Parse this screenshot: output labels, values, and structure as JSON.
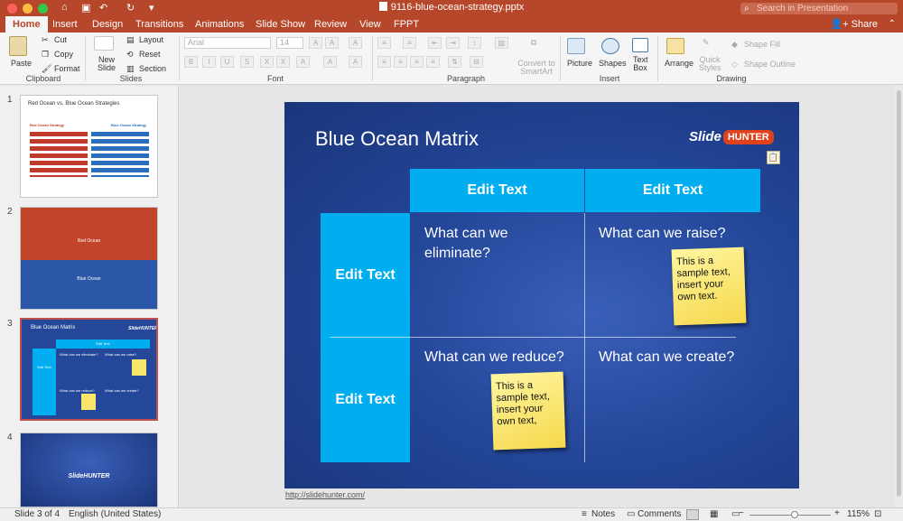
{
  "window": {
    "title": "9116-blue-ocean-strategy.pptx",
    "search_placeholder": "Search in Presentation"
  },
  "tabs": [
    {
      "label": "Home",
      "active": true
    },
    {
      "label": "Insert"
    },
    {
      "label": "Design"
    },
    {
      "label": "Transitions"
    },
    {
      "label": "Animations"
    },
    {
      "label": "Slide Show"
    },
    {
      "label": "Review"
    },
    {
      "label": "View"
    },
    {
      "label": "FPPT"
    }
  ],
  "share_label": "Share",
  "ribbon": {
    "clipboard": {
      "paste": "Paste",
      "cut": "Cut",
      "copy": "Copy",
      "format": "Format",
      "group": "Clipboard"
    },
    "slides": {
      "new_slide": "New Slide",
      "layout": "Layout",
      "reset": "Reset",
      "section": "Section",
      "group": "Slides"
    },
    "font": {
      "font_name": "Arial",
      "font_size": "14",
      "group": "Font"
    },
    "paragraph": {
      "convert": "Convert to SmartArt",
      "group": "Paragraph"
    },
    "insert": {
      "picture": "Picture",
      "shapes": "Shapes",
      "textbox": "Text Box",
      "group": "Insert"
    },
    "drawing": {
      "arrange": "Arrange",
      "quick_styles": "Quick Styles",
      "shape_fill": "Shape Fill",
      "shape_outline": "Shape Outline",
      "group": "Drawing"
    }
  },
  "thumbnails": [
    {
      "num": "1",
      "title": "Red Ocean vs. Blue Ocean Strategies",
      "left": "Red Ocean Strategy",
      "right": "Blue Ocean Strategy"
    },
    {
      "num": "2",
      "top": "Red Ocean",
      "bottom": "Blue Ocean"
    },
    {
      "num": "3",
      "title": "Blue Ocean Matrix",
      "header": "Edit Text",
      "row": "Edit Text",
      "q1": "What can we eliminate?",
      "q2": "What can we raise?",
      "q3": "What can we reduce?",
      "q4": "What can we create?",
      "logo": "SlideHUNTER"
    },
    {
      "num": "4",
      "logo": "SlideHUNTER"
    }
  ],
  "slide": {
    "title": "Blue Ocean Matrix",
    "logo_slide": "Slide",
    "logo_hunter": "HUNTER",
    "col_header_1": "Edit Text",
    "col_header_2": "Edit Text",
    "row_header_1": "Edit Text",
    "row_header_2": "Edit Text",
    "q_eliminate": "What can we eliminate?",
    "q_raise": "What can we raise?",
    "q_reduce": "What can we reduce?",
    "q_create": "What can we create?",
    "note_1": "This is a sample text, insert your own text.",
    "note_2": "This is a sample text, insert your own text,"
  },
  "url": "http://slidehunter.com/",
  "status": {
    "slide_count": "Slide 3 of 4",
    "language": "English (United States)",
    "notes": "Notes",
    "comments": "Comments",
    "zoom": "115%"
  }
}
